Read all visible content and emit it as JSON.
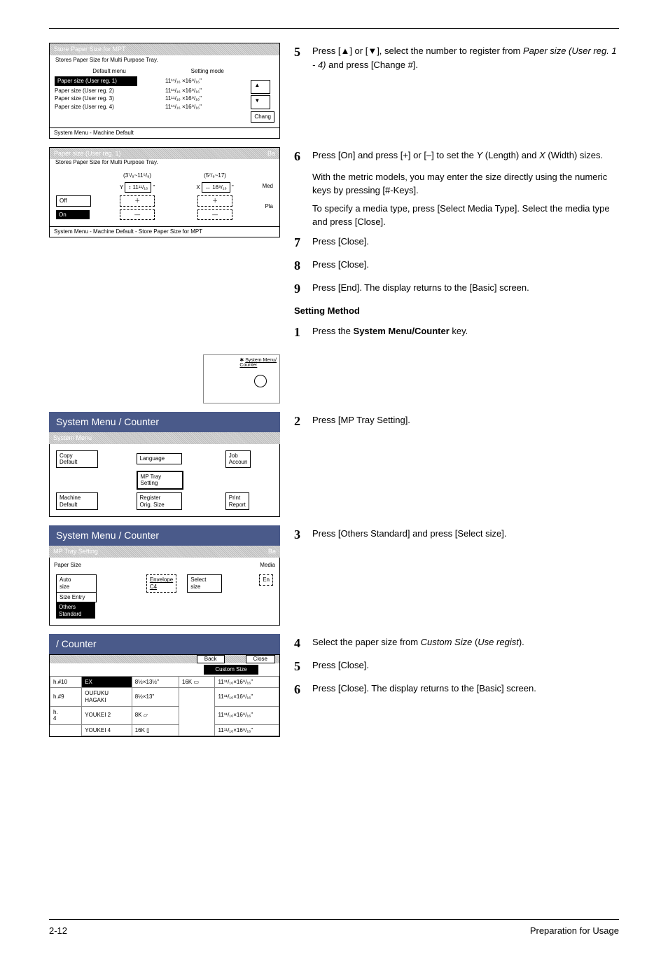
{
  "steps": {
    "s5": "Press [▲] or [▼], select the number to register from ",
    "s5i": "Paper size (User reg. 1 - 4)",
    "s5b": " and press [Change #].",
    "s6a": "Press [On] and press [+] or [–] to set the ",
    "s6y": "Y",
    "s6b": " (Length) and ",
    "s6x": "X",
    "s6c": " (Width) sizes.",
    "s6d": "With the metric models, you may enter the size directly using the numeric keys by pressing [#-Keys].",
    "s6e": "To specify a media type, press [Select Media Type]. Select the media type and press [Close].",
    "s7": "Press [Close].",
    "s8": "Press [Close].",
    "s9": "Press [End]. The display returns to the [Basic] screen.",
    "setmethod": "Setting Method",
    "m1a": "Press the ",
    "m1b": "System Menu/Counter",
    "m1c": " key.",
    "m2": "Press [MP Tray Setting].",
    "m3": "Press [Others Standard] and press [Select size].",
    "m4a": "Select the paper size from ",
    "m4b": "Custom Size",
    "m4c": " (",
    "m4d": "Use regist",
    "m4e": ").",
    "m5": "Press [Close].",
    "m6": "Press [Close]. The display returns to the [Basic] screen."
  },
  "panel1": {
    "title": "Store Paper Size for MPT",
    "sub": "Stores Paper Size for Multi Purpose Tray.",
    "colA": "Default menu",
    "colB": "Setting mode",
    "r1a": "Paper size (User reg. 1)",
    "r1b": "11¹¹/₁₆ ×16⁹/₁₆\"",
    "r2a": "Paper size (User reg. 2)",
    "r2b": "11¹¹/₁₆ ×16⁹/₁₆\"",
    "r3a": "Paper size (User reg. 3)",
    "r3b": "11¹¹/₁₆ ×16⁹/₁₆\"",
    "r4a": "Paper size (User reg. 4)",
    "r4b": "11¹¹/₁₆ ×16⁹/₁₆\"",
    "change": "Chang",
    "foot": "System Menu       -   Machine Default"
  },
  "panel2": {
    "title": "Paper size (User reg. 1)",
    "titleR": "Ba",
    "sub": "Stores Paper Size for Multi Purpose Tray.",
    "yrange": "(3⁷/₈~11⁵/₈)",
    "xrange": "(5⁷/₈~17)",
    "yval": "↕ 11¹¹/₁₆",
    "xval": "↔ 16⁹/₁₆",
    "off": "Off",
    "on": "On",
    "plus": "＋",
    "minus": "—",
    "med": "Med",
    "pla": "Pla",
    "foot": "System Menu       -   Machine Default       -    Store Paper Size for MPT"
  },
  "key": {
    "label": "System Menu/\nCounter",
    "star": "✱"
  },
  "panel3": {
    "header": "System Menu / Counter",
    "title": "System Menu",
    "copy": "Copy\nDefault",
    "machine": "Machine\nDefault",
    "lang": "Language",
    "mp": "MP Tray\nSetting",
    "reg": "Register\nOrig. Size",
    "job": "Job\nAccoun",
    "print": "Print\nReport"
  },
  "panel4": {
    "header": "System Menu / Counter",
    "title": "MP Tray Setting",
    "titleR": "Ba",
    "paper": "Paper Size",
    "media": "Media",
    "auto": "Auto\nsize",
    "entry": "Size Entry",
    "others": "Others\nStandard",
    "env": "Envelope\nC4",
    "select": "Select\nsize",
    "en": "En"
  },
  "panel5": {
    "header": "/ Counter",
    "back": "Back",
    "close": "Close",
    "custom": "Custom Size",
    "cells": {
      "a1": "h.#10",
      "a2": "EX",
      "a3": "8½×13½\"",
      "a4": "16K  ▭",
      "a5": "11¹¹/₁₆×16⁹/₁₆\"",
      "b1": "h.#9",
      "b2": "OUFUKU\nHAGAKI",
      "b3": "8½×13\"",
      "b4": "",
      "b5": "11¹¹/₁₆×16⁹/₁₆\"",
      "c1": "h.\n4",
      "c2": "YOUKEI 2",
      "c3": "8K  ▱",
      "c4": "",
      "c5": "11¹¹/₁₆×16⁹/₁₆\"",
      "d1": "",
      "d2": "YOUKEI 4",
      "d3": "16K  ▯",
      "d4": "",
      "d5": "11¹¹/₁₆×16⁹/₁₆\""
    }
  },
  "footer": {
    "left": "2-12",
    "right": "Preparation for Usage"
  }
}
